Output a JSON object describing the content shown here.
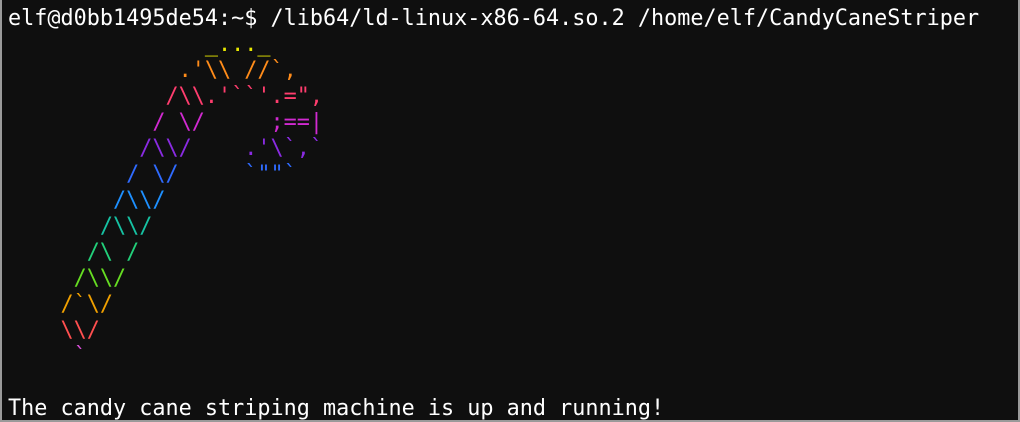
{
  "terminal": {
    "prompt_command": "elf@d0bb1495de54:~$ /lib64/ld-linux-x86-64.so.2 /home/elf/CandyCaneStriper",
    "status_message": "The candy cane striping machine is up and running!"
  },
  "ascii_art": {
    "rows": [
      [
        {
          "t": "           ",
          "c": "#ffffff"
        },
        {
          "t": "_..._",
          "c": "#e8e800"
        }
      ],
      [
        {
          "t": "         .'\\\\ //`,",
          "c": "#ff8c1a"
        }
      ],
      [
        {
          "t": "        /\\\\.'``'.=\",",
          "c": "#ff3d6e"
        },
        {
          "t": "",
          "c": "#ff3d6e"
        }
      ],
      [
        {
          "t": "       / \\/     ;==|",
          "c": "#d12ad1"
        }
      ],
      [
        {
          "t": "      /\\\\/    .'\\`,`",
          "c": "#8a2be2"
        }
      ],
      [
        {
          "t": "     / \\/     `\"\"`",
          "c": "#2f6bff"
        }
      ],
      [
        {
          "t": "    /\\\\/",
          "c": "#1e90ff"
        }
      ],
      [
        {
          "t": "   /\\\\/",
          "c": "#16c2a3"
        }
      ],
      [
        {
          "t": "  /\\ /",
          "c": "#22d07a"
        }
      ],
      [
        {
          "t": " /\\\\/",
          "c": "#66dd22"
        }
      ],
      [
        {
          "t": "/`\\/",
          "c": "#f0a000"
        }
      ],
      [
        {
          "t": "\\\\/",
          "c": "#ff4f4f"
        }
      ],
      [
        {
          "t": " `",
          "c": "#d94fd9"
        }
      ]
    ]
  }
}
